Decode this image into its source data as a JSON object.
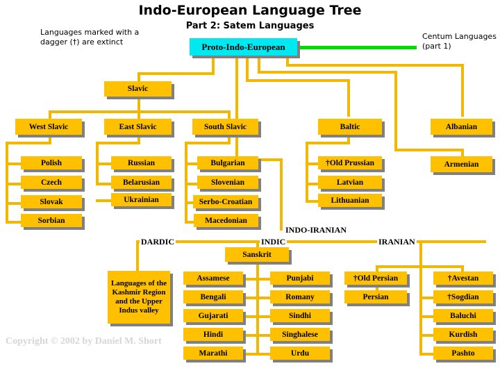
{
  "title": {
    "main": "Indo-European Language Tree",
    "sub": "Part 2: Satem Languages"
  },
  "notes": {
    "extinct": "Languages marked with a dagger (†) are extinct",
    "centum": "Centum Languages (part 1)"
  },
  "copyright": "Copyright © 2002 by Daniel M. Short",
  "colors": {
    "box_fill": "#FFC000",
    "root_fill": "#00E8F0",
    "line": "#F2B800",
    "centum_line": "#00DD00",
    "shadow": "#808080",
    "text": "#000000",
    "copyright_text": "#D6D6D6"
  },
  "captions": {
    "indo_iranian": "INDO-IRANIAN",
    "dardic": "DARDIC",
    "indic": "INDIC",
    "iranian": "IRANIAN"
  },
  "nodes": {
    "root": "Proto-Indo-European",
    "slavic": "Slavic",
    "west_slavic": "West Slavic",
    "east_slavic": "East Slavic",
    "south_slavic": "South Slavic",
    "baltic": "Baltic",
    "albanian": "Albanian",
    "armenian": "Armenian",
    "polish": "Polish",
    "czech": "Czech",
    "slovak": "Slovak",
    "sorbian": "Sorbian",
    "russian": "Russian",
    "belarusian": "Belarusian",
    "ukrainian": "Ukrainian",
    "bulgarian": "Bulgarian",
    "slovenian": "Slovenian",
    "serbo_croatian": "Serbo-Croatian",
    "macedonian": "Macedonian",
    "old_prussian": "†Old Prussian",
    "latvian": "Latvian",
    "lithuanian": "Lithuanian",
    "kashmir": "Languages of the Kashmir Region and the Upper Indus valley",
    "sanskrit": "Sanskrit",
    "assamese": "Assamese",
    "bengali": "Bengali",
    "gujarati": "Gujarati",
    "hindi": "Hindi",
    "marathi": "Marathi",
    "punjabi": "Punjabi",
    "romany": "Romany",
    "sindhi": "Sindhi",
    "singhalese": "Singhalese",
    "urdu": "Urdu",
    "old_persian": "†Old Persian",
    "persian": "Persian",
    "avestan": "†Avestan",
    "sogdian": "†Sogdian",
    "baluchi": "Baluchi",
    "kurdish": "Kurdish",
    "pashto": "Pashto"
  },
  "tree": {
    "root_label": "Proto-Indo-European",
    "children": [
      {
        "label": "Slavic",
        "children": [
          {
            "label": "West Slavic",
            "children": [
              {
                "label": "Polish"
              },
              {
                "label": "Czech"
              },
              {
                "label": "Slovak"
              },
              {
                "label": "Sorbian"
              }
            ]
          },
          {
            "label": "East Slavic",
            "children": [
              {
                "label": "Russian"
              },
              {
                "label": "Belarusian"
              },
              {
                "label": "Ukrainian"
              }
            ]
          },
          {
            "label": "South Slavic",
            "children": [
              {
                "label": "Bulgarian"
              },
              {
                "label": "Slovenian"
              },
              {
                "label": "Serbo-Croatian"
              },
              {
                "label": "Macedonian"
              }
            ]
          }
        ]
      },
      {
        "label": "Baltic",
        "children": [
          {
            "label": "†Old Prussian"
          },
          {
            "label": "Latvian"
          },
          {
            "label": "Lithuanian"
          }
        ]
      },
      {
        "label": "Albanian"
      },
      {
        "label": "Armenian"
      },
      {
        "label": "INDO-IRANIAN",
        "children": [
          {
            "label": "DARDIC",
            "children": [
              {
                "label": "Languages of the Kashmir Region and the Upper Indus valley"
              }
            ]
          },
          {
            "label": "INDIC",
            "children": [
              {
                "label": "Sanskrit",
                "children": [
                  {
                    "label": "Assamese"
                  },
                  {
                    "label": "Bengali"
                  },
                  {
                    "label": "Gujarati"
                  },
                  {
                    "label": "Hindi"
                  },
                  {
                    "label": "Marathi"
                  },
                  {
                    "label": "Punjabi"
                  },
                  {
                    "label": "Romany"
                  },
                  {
                    "label": "Sindhi"
                  },
                  {
                    "label": "Singhalese"
                  },
                  {
                    "label": "Urdu"
                  }
                ]
              }
            ]
          },
          {
            "label": "IRANIAN",
            "children": [
              {
                "label": "†Old Persian",
                "children": [
                  {
                    "label": "Persian"
                  }
                ]
              },
              {
                "label": "†Avestan"
              },
              {
                "label": "†Sogdian"
              },
              {
                "label": "Baluchi"
              },
              {
                "label": "Kurdish"
              },
              {
                "label": "Pashto"
              }
            ]
          }
        ]
      }
    ]
  }
}
